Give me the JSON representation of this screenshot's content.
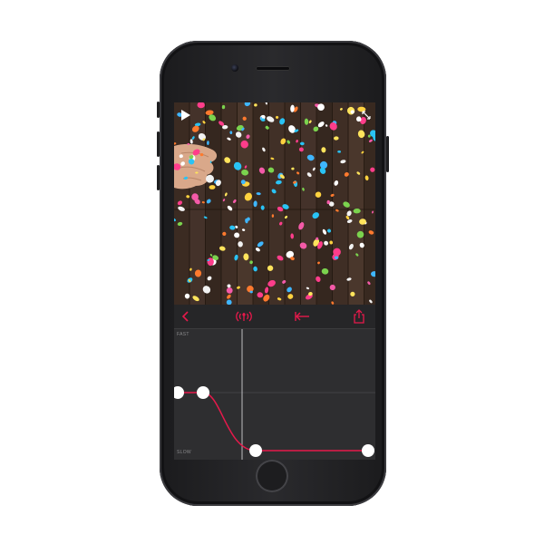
{
  "graph": {
    "fast_label": "FAST",
    "slow_label": "SLOW"
  },
  "icons": {
    "play": "play-icon",
    "fullscreen": "expand-icon",
    "back": "chevron-left-icon",
    "audio": "broadcast-icon",
    "trim": "arrow-to-start-icon",
    "share": "share-icon"
  },
  "colors": {
    "accent": "#e6194b",
    "screen_bg": "#2a2a2c",
    "graph_bg": "#2e2e30"
  }
}
